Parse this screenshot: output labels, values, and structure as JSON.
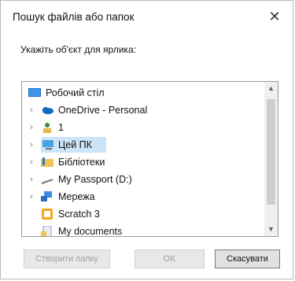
{
  "dialog": {
    "title": "Пошук файлів або папок",
    "close_glyph": "✕",
    "instruction": "Укажіть об'єкт для ярлика:"
  },
  "tree": {
    "items": [
      {
        "label": "Робочий стіл",
        "icon": "desktop-icon",
        "expandable": false
      },
      {
        "label": "OneDrive - Personal",
        "icon": "onedrive-cloud-icon",
        "expandable": true
      },
      {
        "label": "1",
        "icon": "user-folder-icon",
        "expandable": true
      },
      {
        "label": "Цей ПК",
        "icon": "computer-icon",
        "expandable": true,
        "selected": true
      },
      {
        "label": "Бібліотеки",
        "icon": "libraries-icon",
        "expandable": true
      },
      {
        "label": "My Passport (D:)",
        "icon": "drive-icon",
        "expandable": true
      },
      {
        "label": "Мережа",
        "icon": "network-icon",
        "expandable": true
      },
      {
        "label": "Scratch 3",
        "icon": "scratch-app-icon",
        "expandable": false
      },
      {
        "label": "My documents",
        "icon": "documents-icon",
        "expandable": false
      }
    ],
    "chevron_glyph": "›",
    "scroll_up_glyph": "▲",
    "scroll_down_glyph": "▼"
  },
  "buttons": {
    "new_folder": "Створити папку",
    "ok": "OK",
    "cancel": "Скасувати"
  },
  "colors": {
    "selection": "#cce4f7",
    "onedrive": "#0f6cbd",
    "folder": "#f2c14e"
  }
}
